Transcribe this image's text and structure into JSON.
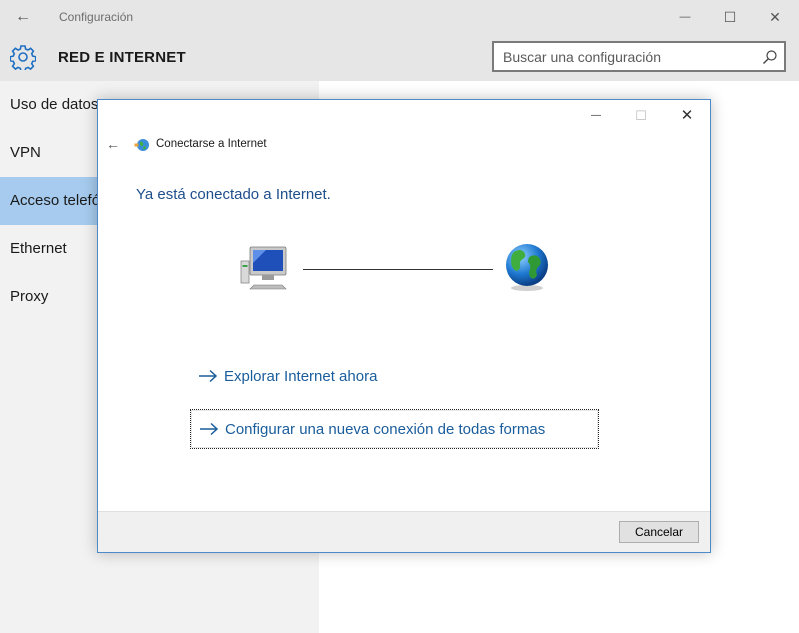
{
  "window": {
    "title": "Configuración",
    "back_glyph": "←",
    "minimize_glyph": "—",
    "maximize_glyph": "☐",
    "close_glyph": "✕"
  },
  "header": {
    "title": "RED E INTERNET",
    "icon": "gear-icon",
    "search_placeholder": "Buscar una configuración"
  },
  "sidebar": {
    "items": [
      {
        "label": "Uso de datos",
        "active": false
      },
      {
        "label": "VPN",
        "active": false
      },
      {
        "label": "Acceso telefónico",
        "active": true
      },
      {
        "label": "Ethernet",
        "active": false
      },
      {
        "label": "Proxy",
        "active": false
      }
    ]
  },
  "dialog": {
    "title": "Conectarse a Internet",
    "back_glyph": "←",
    "minimize_glyph": "—",
    "maximize_glyph": "☐",
    "close_glyph": "✕",
    "heading": "Ya está conectado a Internet.",
    "links": [
      {
        "label": "Explorar Internet ahora",
        "focused": false
      },
      {
        "label": "Configurar una nueva conexión de todas formas",
        "focused": true
      }
    ],
    "cancel_label": "Cancelar"
  },
  "colors": {
    "accent": "#1a5d9c",
    "heading": "#1e4e8c",
    "active_nav": "#a6cbee",
    "dialog_border": "#4e89c9"
  }
}
